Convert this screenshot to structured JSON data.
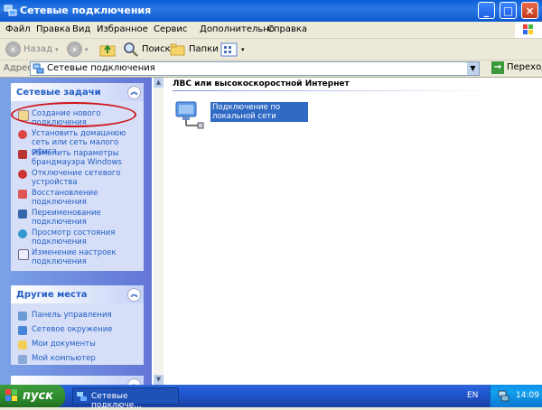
{
  "window": {
    "title": "Сетевые подключения"
  },
  "menu": [
    "Файл",
    "Правка",
    "Вид",
    "Избранное",
    "Сервис",
    "Дополнительно",
    "Справка"
  ],
  "toolbar": {
    "back": "Назад",
    "search": "Поиск",
    "folders": "Папки"
  },
  "address": {
    "label": "Адрес:",
    "value": "Сетевые подключения",
    "go": "Переход"
  },
  "network_tasks": {
    "header": "Сетевые задачи",
    "items": [
      {
        "label": "Создание нового подключения",
        "icon": "new-connection-icon"
      },
      {
        "label": "Установить домашнюю сеть или сеть малого офиса",
        "icon": "home-network-icon"
      },
      {
        "label": "Изменить параметры брандмауэра Windows",
        "icon": "firewall-icon"
      },
      {
        "label": "Отключение сетевого устройства",
        "icon": "disable-device-icon"
      },
      {
        "label": "Восстановление подключения",
        "icon": "repair-icon"
      },
      {
        "label": "Переименование подключения",
        "icon": "rename-icon"
      },
      {
        "label": "Просмотр состояния подключения",
        "icon": "status-icon"
      },
      {
        "label": "Изменение настроек подключения",
        "icon": "settings-icon"
      }
    ]
  },
  "other_places": {
    "header": "Другие места",
    "items": [
      {
        "label": "Панель управления",
        "icon": "control-panel-icon"
      },
      {
        "label": "Сетевое окружение",
        "icon": "network-places-icon"
      },
      {
        "label": "Мои документы",
        "icon": "my-documents-icon"
      },
      {
        "label": "Мой компьютер",
        "icon": "my-computer-icon"
      }
    ]
  },
  "main": {
    "group_title": "ЛВС или высокоскоростной Интернет",
    "connection_label": "Подключение по локальной сети"
  },
  "taskbar": {
    "start": "пуск",
    "task_button": "Сетевые подключе...",
    "language": "EN",
    "time": "14:09"
  },
  "colors": {
    "accent": "#215dc6",
    "selection": "#316ac5",
    "annotation": "#d0141a"
  }
}
